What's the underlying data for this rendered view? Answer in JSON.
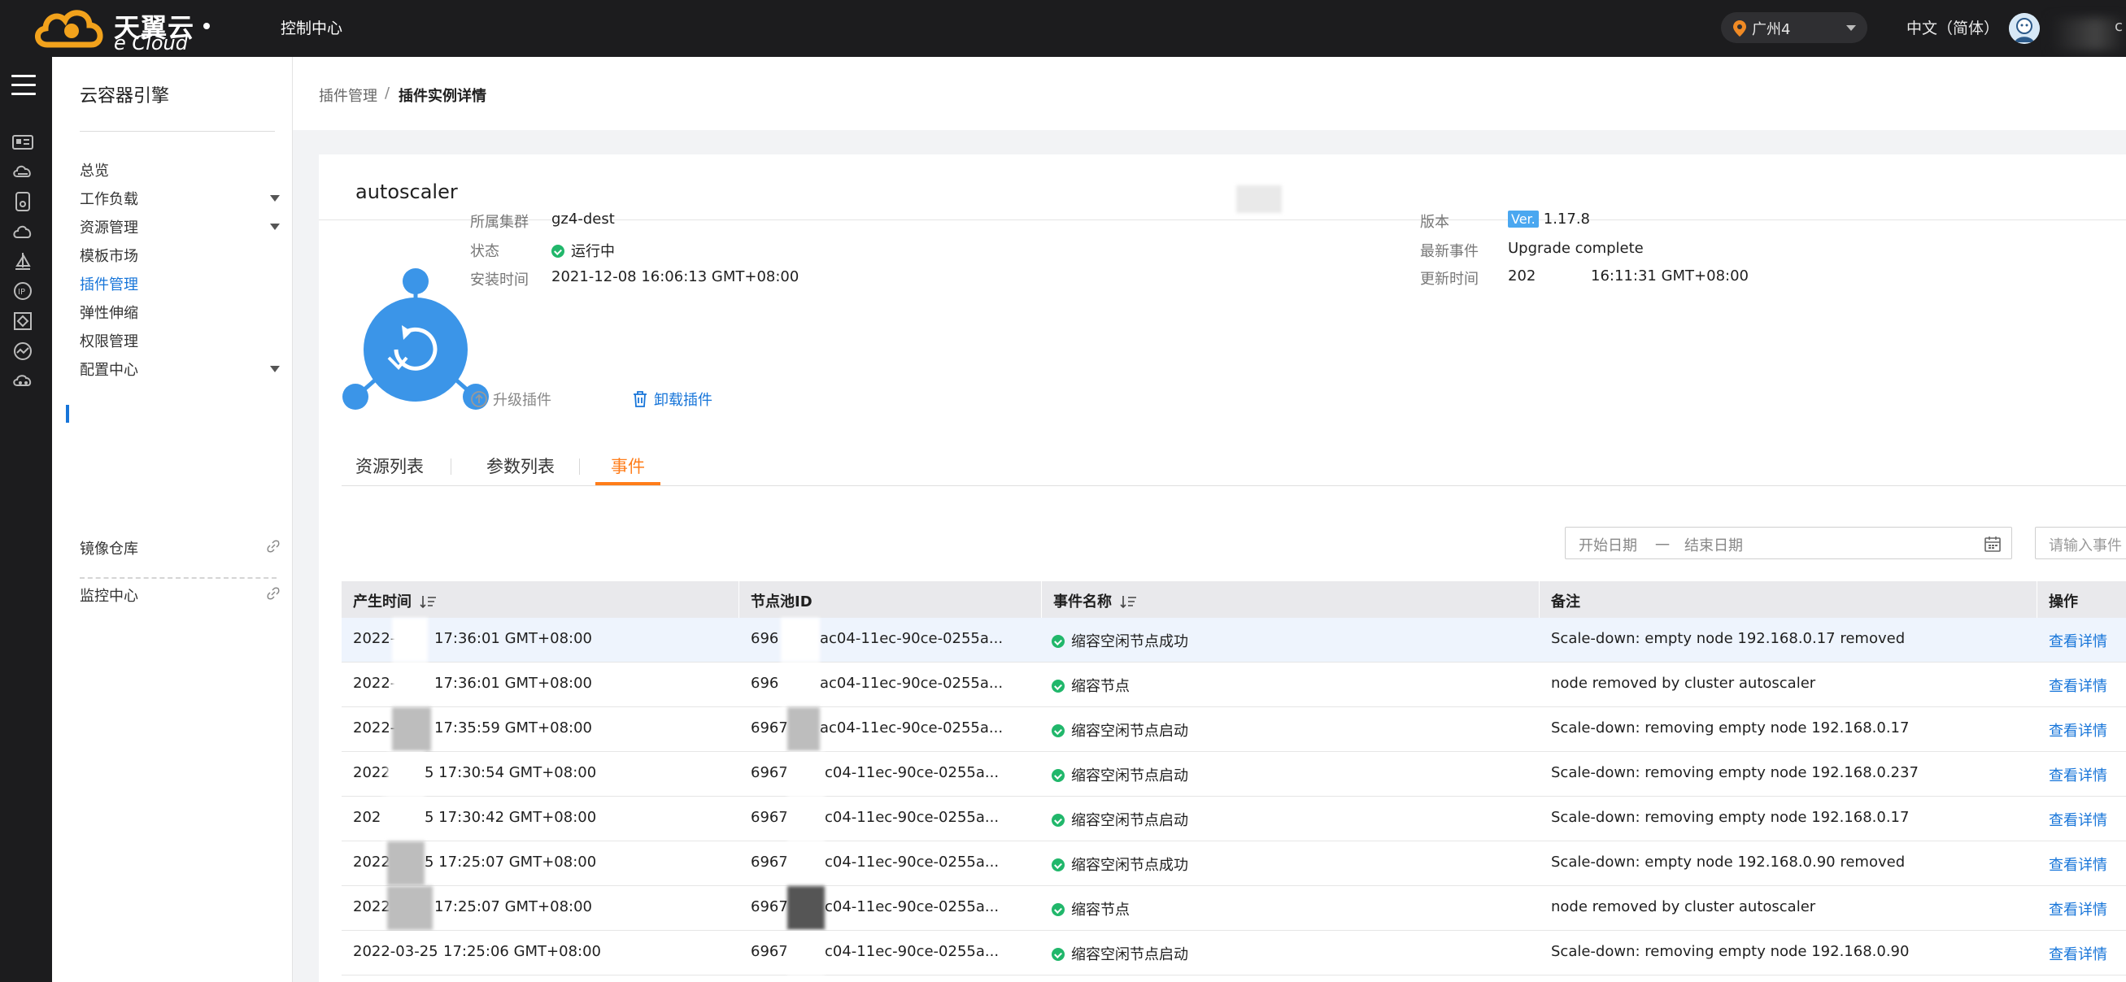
{
  "topbar": {
    "brand_cn": "天翼云",
    "brand_en": "e Cloud",
    "console": "控制中心",
    "region": "广州4",
    "language": "中文（简体）",
    "user_fragment": "c"
  },
  "sidebar": {
    "title": "云容器引擎",
    "items": [
      {
        "label": "总览",
        "expandable": false
      },
      {
        "label": "工作负载",
        "expandable": true
      },
      {
        "label": "资源管理",
        "expandable": true
      },
      {
        "label": "模板市场",
        "expandable": false
      },
      {
        "label": "插件管理",
        "expandable": false,
        "active": true
      },
      {
        "label": "弹性伸缩",
        "expandable": false
      },
      {
        "label": "权限管理",
        "expandable": false
      },
      {
        "label": "配置中心",
        "expandable": true
      },
      {
        "label": "镜像仓库",
        "external": true
      },
      {
        "label": "监控中心",
        "external": true
      }
    ]
  },
  "breadcrumb": {
    "parent": "插件管理",
    "separator": "/",
    "current": "插件实例详情"
  },
  "plugin": {
    "name": "autoscaler",
    "cluster_label": "所属集群",
    "cluster": "gz4-dest",
    "status_label": "状态",
    "status": "运行中",
    "install_time_label": "安装时间",
    "install_time": "2021-12-08 16:06:13 GMT+08:00",
    "version_label": "版本",
    "version_badge": "Ver.",
    "version": "1.17.8",
    "latest_event_label": "最新事件",
    "latest_event": "Upgrade complete",
    "update_time_label": "更新时间",
    "update_time_prefix": "202",
    "update_time_suffix": "16:11:31 GMT+08:00",
    "upgrade_action": "升级插件",
    "uninstall_action": "卸载插件"
  },
  "tabs": [
    {
      "label": "资源列表",
      "active": false
    },
    {
      "label": "参数列表",
      "active": false
    },
    {
      "label": "事件",
      "active": true
    }
  ],
  "filters": {
    "start_placeholder": "开始日期",
    "range_separator": "一",
    "end_placeholder": "结束日期",
    "search_placeholder": "请输入事件"
  },
  "table": {
    "headers": {
      "time": "产生时间",
      "nodepool": "节点池ID",
      "event": "事件名称",
      "remark": "备注",
      "action": "操作"
    },
    "rows": [
      {
        "time_a": "2022-",
        "time_b": "17:36:01 GMT+08:00",
        "np_a": "696",
        "np_b": "ac04-11ec-90ce-0255a...",
        "event": "缩容空闲节点成功",
        "remark": "Scale-down: empty node 192.168.0.17 removed",
        "action": "查看详情"
      },
      {
        "time_a": "2022-",
        "time_b": "17:36:01 GMT+08:00",
        "np_a": "696",
        "np_b": "ac04-11ec-90ce-0255a...",
        "event": "缩容节点",
        "remark": "node removed by cluster autoscaler",
        "action": "查看详情"
      },
      {
        "time_a": "2022-",
        "time_b": "17:35:59 GMT+08:00",
        "np_a": "6967",
        "np_b": "ac04-11ec-90ce-0255a...",
        "event": "缩容空闲节点启动",
        "remark": "Scale-down: removing empty node 192.168.0.17",
        "action": "查看详情"
      },
      {
        "time_a": "2022",
        "time_b": "5 17:30:54 GMT+08:00",
        "np_a": "6967",
        "np_b": "c04-11ec-90ce-0255a...",
        "event": "缩容空闲节点启动",
        "remark": "Scale-down: removing empty node 192.168.0.237",
        "action": "查看详情"
      },
      {
        "time_a": "202",
        "time_b": "5 17:30:42 GMT+08:00",
        "np_a": "6967",
        "np_b": "c04-11ec-90ce-0255a...",
        "event": "缩容空闲节点启动",
        "remark": "Scale-down: removing empty node 192.168.0.17",
        "action": "查看详情"
      },
      {
        "time_a": "2022",
        "time_b": "5 17:25:07 GMT+08:00",
        "np_a": "6967",
        "np_b": "c04-11ec-90ce-0255a...",
        "event": "缩容空闲节点成功",
        "remark": "Scale-down: empty node 192.168.0.90 removed",
        "action": "查看详情"
      },
      {
        "time_a": "2022",
        "time_b": "17:25:07 GMT+08:00",
        "np_a": "6967",
        "np_b": "c04-11ec-90ce-0255a...",
        "event": "缩容节点",
        "remark": "node removed by cluster autoscaler",
        "action": "查看详情"
      },
      {
        "time_a": "2022-03-25",
        "time_b": "17:25:06 GMT+08:00",
        "np_a": "6967",
        "np_b": "c04-11ec-90ce-0255a...",
        "event": "缩容空闲节点启动",
        "remark": "Scale-down: removing empty node 192.168.0.90",
        "action": "查看详情"
      }
    ]
  },
  "colors": {
    "accent_blue": "#1775d9",
    "tab_orange": "#ff7d1a",
    "status_green": "#21b76b",
    "topbar": "#1c1c1e"
  }
}
